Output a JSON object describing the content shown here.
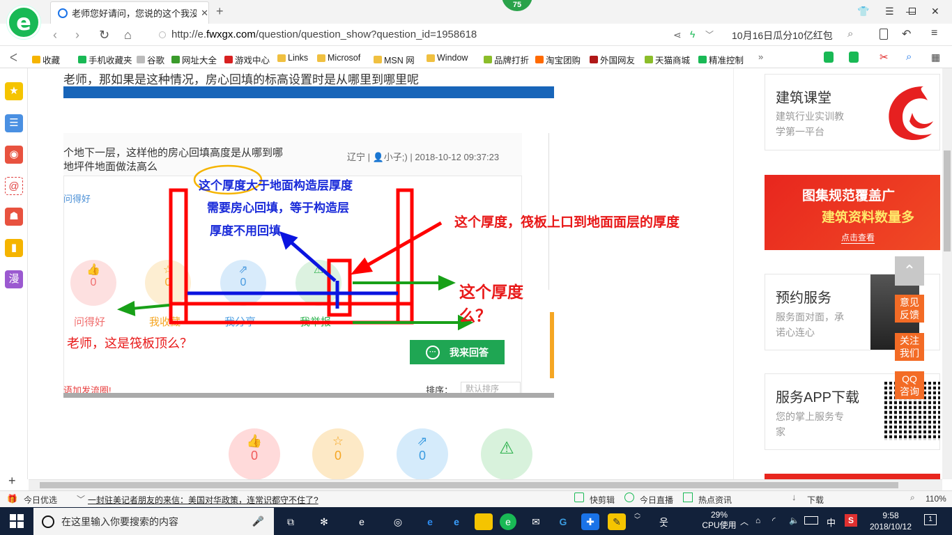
{
  "browser": {
    "tab_title": "老师您好请问，您说的这个我没太",
    "badge": "75",
    "url": "http://e.fwxgx.com/question/question_show?question_id=1958618",
    "url_prefix": "http://e.",
    "url_domain": "fwxgx.com",
    "url_path": "/question/question_show?question_id=1958618",
    "promo": "10月16日瓜分10亿红包"
  },
  "bookmarks": [
    {
      "label": "收藏",
      "color": "#f5b400"
    },
    {
      "label": "手机收藏夹",
      "color": "#19b955"
    },
    {
      "label": "谷歌",
      "color": "#bbbbbb"
    },
    {
      "label": "网址大全",
      "color": "#3a9b2b"
    },
    {
      "label": "游戏中心",
      "color": "#d82020"
    },
    {
      "label": "Links",
      "color": "#f0c040"
    },
    {
      "label": "Microsof",
      "color": "#f0c040"
    },
    {
      "label": "MSN 网",
      "color": "#f0c040"
    },
    {
      "label": "Window",
      "color": "#f0c040"
    },
    {
      "label": "品牌打折",
      "color": "#8bbd2a"
    },
    {
      "label": "淘宝团购",
      "color": "#ff6a00"
    },
    {
      "label": "外国网友",
      "color": "#b01818"
    },
    {
      "label": "天猫商城",
      "color": "#8bbd2a"
    },
    {
      "label": "精准控制",
      "color": "#19b955"
    }
  ],
  "question": {
    "header": "老师，那如果是这种情况，房心回填的标高设置时是从哪里到哪里呢"
  },
  "screenshot": {
    "title_line1": "个地下一层，这样他的房心回填高度是从哪到哪",
    "title_line2": "地坪件地面做法高么",
    "location": "辽宁 | ",
    "user": "小子;)",
    "datetime": "| 2018-10-12 09:37:23",
    "side_text": "问得好",
    "stat_labels": [
      "问得好",
      "我收藏",
      "我分享",
      "我举报"
    ],
    "stat_values": [
      "0",
      "0",
      "0"
    ],
    "answer_button": "我来回答",
    "bottom_left": "语加发流圈!",
    "sort_label": "排序：",
    "sort_value": "默认排序"
  },
  "annotations": {
    "blue_line1": "这个厚度大于地面构造层厚度",
    "blue_line2": "需要房心回填，等于构造层",
    "blue_line3": "厚度不用回填",
    "red_right": "这个厚度，筏板上口到地面面层的厚度",
    "red_mid_line1": "这个厚度",
    "red_mid_line2": "么？",
    "red_bottom": "老师，这是筏板顶么？"
  },
  "actions": [
    {
      "name": "like",
      "value": "0",
      "color": "#ffdada",
      "icon": "👍",
      "fg": "#f05a5a"
    },
    {
      "name": "collect",
      "value": "0",
      "color": "#fde9c6",
      "icon": "☆",
      "fg": "#f5a623"
    },
    {
      "name": "share",
      "value": "0",
      "color": "#d5ebfb",
      "icon": "⇗",
      "fg": "#3a9be0"
    },
    {
      "name": "report",
      "value": "",
      "color": "#d8f2dc",
      "icon": "⚠",
      "fg": "#2ab04a"
    }
  ],
  "right_cards": {
    "card1_title": "建筑课堂",
    "card1_sub1": "建筑行业实训教",
    "card1_sub2": "学第一平台",
    "banner_line1": "图集规范覆盖广",
    "banner_line2": "建筑资料数量多",
    "banner_btn": "点击查看",
    "card2_title": "预约服务",
    "card2_sub1": "服务面对面，承",
    "card2_sub2": "诺心连心",
    "card3_title": "服务APP下载",
    "card3_sub1": "您的掌上服务专",
    "card3_sub2": "家"
  },
  "float_buttons": [
    "意见反馈",
    "关注我们",
    "QQ咨询"
  ],
  "statusbar": {
    "left": "今日优选",
    "news": "一封驻美记者朋友的来信：美国对华政策，连常识都守不住了?",
    "items": [
      "快剪辑",
      "今日直播",
      "热点资讯",
      "下载"
    ],
    "zoom": "110%"
  },
  "taskbar": {
    "search_placeholder": "在这里输入你要搜索的内容",
    "cpu_pct": "29%",
    "cpu_label": "CPU使用",
    "ime": "中",
    "time": "9:58",
    "date": "2018/10/12",
    "notif": "1"
  }
}
